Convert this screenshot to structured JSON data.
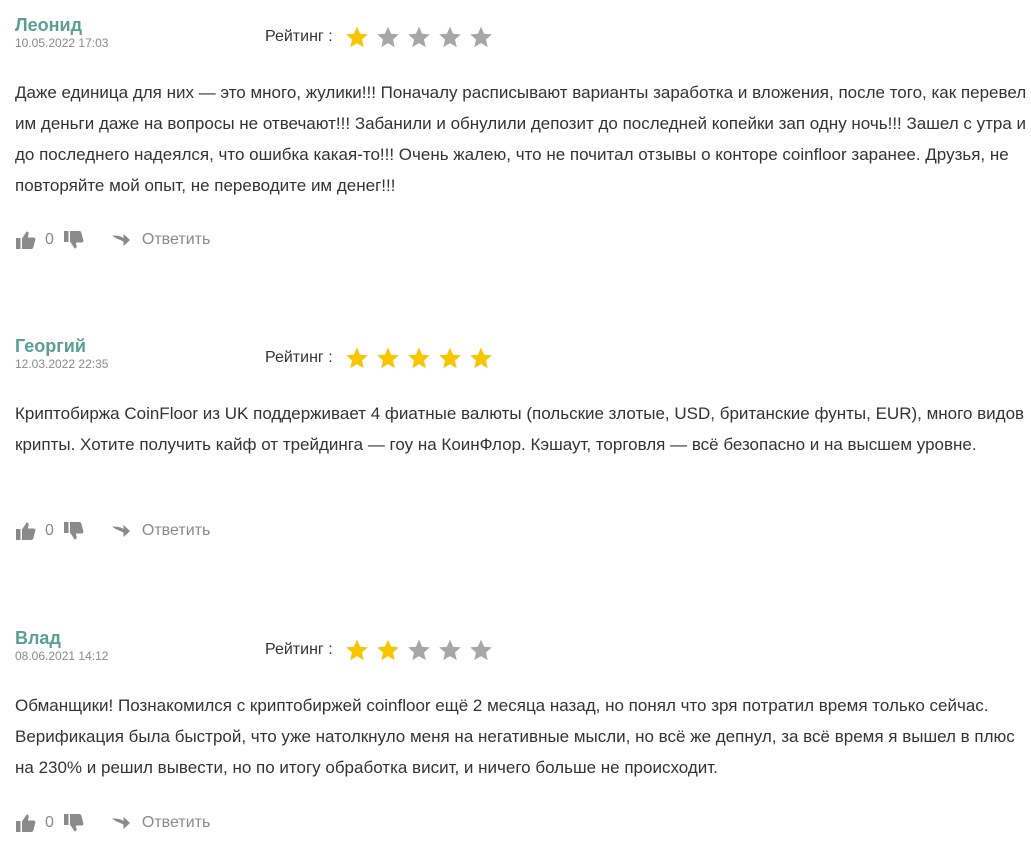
{
  "colors": {
    "author": "#5a9e96",
    "star_filled": "#f7c600",
    "star_empty": "#a7a7a7",
    "muted": "#8a8a8a",
    "text": "#333333"
  },
  "reviews": [
    {
      "author": "Леонид",
      "date": "10.05.2022 17:03",
      "rating_label": "Рейтинг :",
      "rating": 1,
      "rating_max": 5,
      "text": "Даже единица для них — это много, жулики!!! Поначалу расписывают варианты заработка и вложения, после того, как перевел им деньги даже на вопросы не отвечают!!! Забанили и обнулили депозит до последней копейки зап одну ночь!!! Зашел с утра и до последнего надеялся, что ошибка какая-то!!! Очень жалею, что не почитал отзывы о конторе coinfloor заранее. Друзья, не повторяйте мой опыт, не переводите им денег!!!",
      "votes": "0",
      "reply_label": "Ответить",
      "icons": {
        "like": "thumbs-up-icon",
        "dislike": "thumbs-down-icon",
        "reply": "reply-arrow-icon"
      }
    },
    {
      "author": "Георгий",
      "date": "12.03.2022 22:35",
      "rating_label": "Рейтинг :",
      "rating": 5,
      "rating_max": 5,
      "text": "Криптобиржа CoinFloor из UK поддерживает 4 фиатные валюты (польские злотые, USD, британские фунты, EUR), много видов крипты. Хотите получить кайф от трейдинга — гоу на КоинФлор. Кэшаут, торговля — всё безопасно и на высшем уровне.",
      "votes": "0",
      "reply_label": "Ответить",
      "icons": {
        "like": "thumbs-up-icon",
        "dislike": "thumbs-down-icon",
        "reply": "reply-arrow-icon"
      }
    },
    {
      "author": "Влад",
      "date": "08.06.2021 14:12",
      "rating_label": "Рейтинг :",
      "rating": 2,
      "rating_max": 5,
      "text": "Обманщики! Познакомился с криптобиржей coinfloor ещё 2 месяца назад, но понял что зря потратил время только сейчас. Верификация была быстрой, что уже натолкнуло меня на негативные мысли, но всё же депнул, за всё время я вышел в плюс на 230% и решил вывести, но по итогу обработка висит, и ничего больше не происходит.",
      "votes": "0",
      "reply_label": "Ответить",
      "icons": {
        "like": "thumbs-up-icon",
        "dislike": "thumbs-down-icon",
        "reply": "reply-arrow-icon"
      }
    }
  ]
}
